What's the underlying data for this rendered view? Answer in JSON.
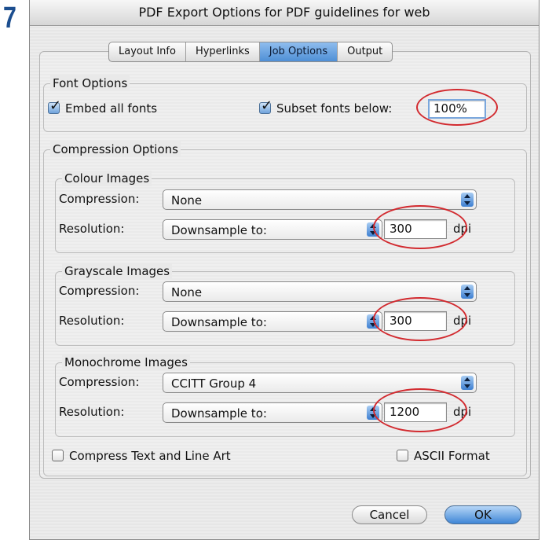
{
  "step": "7",
  "window": {
    "title": "PDF Export Options for PDF guidelines for web"
  },
  "tabs": [
    {
      "label": "Layout Info",
      "selected": false
    },
    {
      "label": "Hyperlinks",
      "selected": false
    },
    {
      "label": "Job Options",
      "selected": true
    },
    {
      "label": "Output",
      "selected": false
    }
  ],
  "font_options": {
    "title": "Font Options",
    "embed_all_fonts": {
      "label": "Embed all fonts",
      "checked": true
    },
    "subset_fonts": {
      "label": "Subset fonts below:",
      "checked": true,
      "value": "100%"
    }
  },
  "compression": {
    "title": "Compression Options",
    "compression_label": "Compression:",
    "resolution_label": "Resolution:",
    "unit": "dpi",
    "colour": {
      "title": "Colour Images",
      "compression": "None",
      "resolution_mode": "Downsample to:",
      "resolution": "300"
    },
    "grayscale": {
      "title": "Grayscale Images",
      "compression": "None",
      "resolution_mode": "Downsample to:",
      "resolution": "300"
    },
    "monochrome": {
      "title": "Monochrome Images",
      "compression": "CCITT Group 4",
      "resolution_mode": "Downsample to:",
      "resolution": "1200"
    },
    "compress_text": {
      "label": "Compress Text and Line Art",
      "checked": false
    },
    "ascii_format": {
      "label": "ASCII Format",
      "checked": false
    }
  },
  "buttons": {
    "cancel": "Cancel",
    "ok": "OK"
  },
  "colors": {
    "annotation": "#d22a2f",
    "step_number": "#1c4e8f",
    "selected_tab": "#4f8fd6"
  }
}
